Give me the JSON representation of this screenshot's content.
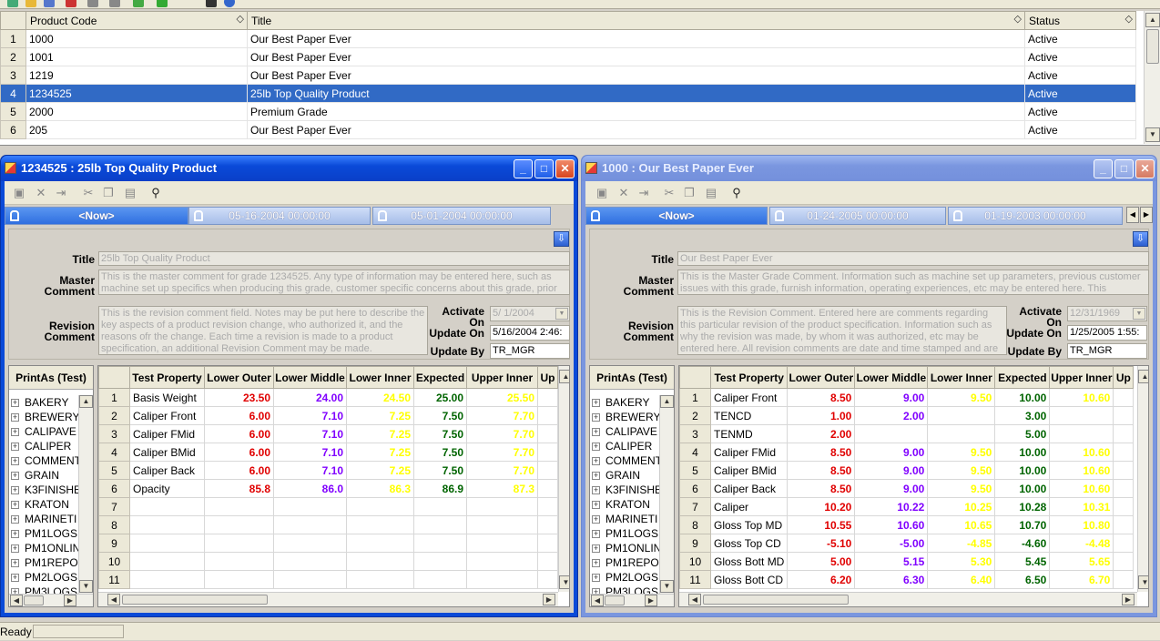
{
  "top_grid": {
    "columns": [
      "Product Code",
      "Title",
      "Status"
    ],
    "sort_glyph": "◇",
    "rows": [
      {
        "n": "1",
        "code": "1000",
        "title": "Our Best Paper Ever",
        "status": "Active"
      },
      {
        "n": "2",
        "code": "1001",
        "title": "Our Best Paper Ever",
        "status": "Active"
      },
      {
        "n": "3",
        "code": "1219",
        "title": "Our Best Paper Ever",
        "status": "Active"
      },
      {
        "n": "4",
        "code": "1234525",
        "title": "25lb Top Quality Product",
        "status": "Active"
      },
      {
        "n": "5",
        "code": "2000",
        "title": "Premium Grade",
        "status": "Active"
      },
      {
        "n": "6",
        "code": "205",
        "title": "Our Best Paper Ever",
        "status": "Active"
      }
    ]
  },
  "win_left": {
    "title": "1234525 : 25lb Top Quality Product",
    "tabs": [
      "<Now>",
      "05-16-2004 00:00:00",
      "05-01-2004 00:00:00"
    ],
    "labels": {
      "title": "Title",
      "master": "Master Comment",
      "revision": "Revision Comment",
      "activate": "Activate On",
      "update_on": "Update On",
      "update_by": "Update By"
    },
    "title_value": "25lb Top Quality Product",
    "master_comment": "This is the master comment for grade 1234525. Any type of information may be entered here, such as machine set up specifics when producing this grade, customer specific concerns about this grade, prior",
    "revision_comment": "This is the revision comment field. Notes may be put here to describe the key aspects of a product revision change, who authorized it, and the reasons ofr the change. Each time a revision is made to a product specification, an additional Revision Comment may be made.",
    "activate_on": "5/  1/2004",
    "update_on": "5/16/2004 2:46:",
    "update_by": "TR_MGR",
    "tree_head": "PrintAs (Test)",
    "tree_items": [
      "BAKERY",
      "BREWERY",
      "CALIPAVE",
      "CALIPER",
      "COMMENT",
      "GRAIN",
      "K3FINISHE",
      "KRATON",
      "MARINETI",
      "PM1LOGS",
      "PM1ONLIN",
      "PM1REPO",
      "PM2LOGS",
      "PM3LOGS"
    ],
    "grid_headers": [
      "Test Property",
      "Lower Outer",
      "Lower Middle",
      "Lower Inner",
      "Expected",
      "Upper Inner",
      "Up"
    ],
    "rows": [
      {
        "n": "1",
        "prop": "Basis Weight",
        "lo": "23.50",
        "lm": "24.00",
        "li": "24.50",
        "ex": "25.00",
        "ui": "25.50"
      },
      {
        "n": "2",
        "prop": "Caliper Front",
        "lo": "6.00",
        "lm": "7.10",
        "li": "7.25",
        "ex": "7.50",
        "ui": "7.70"
      },
      {
        "n": "3",
        "prop": "Caliper FMid",
        "lo": "6.00",
        "lm": "7.10",
        "li": "7.25",
        "ex": "7.50",
        "ui": "7.70"
      },
      {
        "n": "4",
        "prop": "Caliper BMid",
        "lo": "6.00",
        "lm": "7.10",
        "li": "7.25",
        "ex": "7.50",
        "ui": "7.70"
      },
      {
        "n": "5",
        "prop": "Caliper Back",
        "lo": "6.00",
        "lm": "7.10",
        "li": "7.25",
        "ex": "7.50",
        "ui": "7.70"
      },
      {
        "n": "6",
        "prop": "Opacity",
        "lo": "85.8",
        "lm": "86.0",
        "li": "86.3",
        "ex": "86.9",
        "ui": "87.3"
      },
      {
        "n": "7",
        "prop": "",
        "lo": "",
        "lm": "",
        "li": "",
        "ex": "",
        "ui": ""
      },
      {
        "n": "8",
        "prop": "",
        "lo": "",
        "lm": "",
        "li": "",
        "ex": "",
        "ui": ""
      },
      {
        "n": "9",
        "prop": "",
        "lo": "",
        "lm": "",
        "li": "",
        "ex": "",
        "ui": ""
      },
      {
        "n": "10",
        "prop": "",
        "lo": "",
        "lm": "",
        "li": "",
        "ex": "",
        "ui": ""
      },
      {
        "n": "11",
        "prop": "",
        "lo": "",
        "lm": "",
        "li": "",
        "ex": "",
        "ui": ""
      }
    ]
  },
  "win_right": {
    "title": "1000 : Our Best Paper Ever",
    "tabs": [
      "<Now>",
      "01-24-2005 00:00:00",
      "01-19-2003 00:00:00"
    ],
    "labels": {
      "title": "Title",
      "master": "Master Comment",
      "revision": "Revision Comment",
      "activate": "Activate On",
      "update_on": "Update On",
      "update_by": "Update By"
    },
    "title_value": "Our Best Paper Ever",
    "master_comment": "This is the Master Grade Comment. Information such as machine set up parameters, previous customer issues with this grade, furnish information, operating experiences, etc may be entered here. This information is",
    "revision_comment": "This is the Revision Comment. Entered here are comments regarding this particular revision of the product specification. Information such as why the revision was made, by whom it was authorized, etc may be entered here. All revision comments are date and time stamped and are viewed along with",
    "activate_on": "12/31/1969",
    "update_on": "1/25/2005 1:55:",
    "update_by": "TR_MGR",
    "tree_head": "PrintAs (Test)",
    "tree_items": [
      "BAKERY",
      "BREWERY",
      "CALIPAVE",
      "CALIPER",
      "COMMENT",
      "GRAIN",
      "K3FINISHE",
      "KRATON",
      "MARINETI",
      "PM1LOGS",
      "PM1ONLIN",
      "PM1REPO",
      "PM2LOGS",
      "PM3LOGS"
    ],
    "grid_headers": [
      "Test Property",
      "Lower Outer",
      "Lower Middle",
      "Lower Inner",
      "Expected",
      "Upper Inner",
      "Up"
    ],
    "rows": [
      {
        "n": "1",
        "prop": "Caliper Front",
        "lo": "8.50",
        "lm": "9.00",
        "li": "9.50",
        "ex": "10.00",
        "ui": "10.60"
      },
      {
        "n": "2",
        "prop": "TENCD",
        "lo": "1.00",
        "lm": "2.00",
        "li": "",
        "ex": "3.00",
        "ui": ""
      },
      {
        "n": "3",
        "prop": "TENMD",
        "lo": "2.00",
        "lm": "",
        "li": "",
        "ex": "5.00",
        "ui": ""
      },
      {
        "n": "4",
        "prop": "Caliper FMid",
        "lo": "8.50",
        "lm": "9.00",
        "li": "9.50",
        "ex": "10.00",
        "ui": "10.60"
      },
      {
        "n": "5",
        "prop": "Caliper BMid",
        "lo": "8.50",
        "lm": "9.00",
        "li": "9.50",
        "ex": "10.00",
        "ui": "10.60"
      },
      {
        "n": "6",
        "prop": "Caliper Back",
        "lo": "8.50",
        "lm": "9.00",
        "li": "9.50",
        "ex": "10.00",
        "ui": "10.60"
      },
      {
        "n": "7",
        "prop": "Caliper",
        "lo": "10.20",
        "lm": "10.22",
        "li": "10.25",
        "ex": "10.28",
        "ui": "10.31"
      },
      {
        "n": "8",
        "prop": "Gloss Top MD",
        "lo": "10.55",
        "lm": "10.60",
        "li": "10.65",
        "ex": "10.70",
        "ui": "10.80"
      },
      {
        "n": "9",
        "prop": "Gloss Top CD",
        "lo": "-5.10",
        "lm": "-5.00",
        "li": "-4.85",
        "ex": "-4.60",
        "ui": "-4.48"
      },
      {
        "n": "10",
        "prop": "Gloss Bott MD",
        "lo": "5.00",
        "lm": "5.15",
        "li": "5.30",
        "ex": "5.45",
        "ui": "5.65"
      },
      {
        "n": "11",
        "prop": "Gloss Bott CD",
        "lo": "6.20",
        "lm": "6.30",
        "li": "6.40",
        "ex": "6.50",
        "ui": "6.70"
      }
    ]
  },
  "status": {
    "text": "Ready"
  },
  "colors": {
    "selection": "#316ac5",
    "lower_outer": "#e00000",
    "lower_middle": "#8000ff",
    "lower_inner": "#ffff00",
    "expected": "#006400",
    "upper_inner": "#ffff00"
  }
}
